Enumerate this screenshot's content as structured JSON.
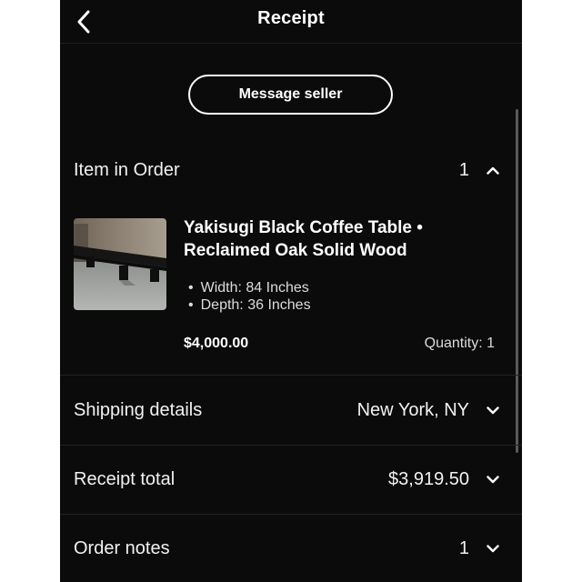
{
  "nav": {
    "title": "Receipt",
    "back_icon": "chevron-left-icon"
  },
  "actions": {
    "message_seller_label": "Message seller"
  },
  "item_section": {
    "label": "Item in Order",
    "count": "1",
    "toggle_icon": "chevron-up-icon",
    "item": {
      "title_line1": "Yakisugi Black Coffee Table •",
      "title_line2": "Reclaimed Oak Solid Wood",
      "specs": [
        "Width: 84 Inches",
        "Depth: 36 Inches"
      ],
      "price": "$4,000.00",
      "quantity": "Quantity: 1"
    }
  },
  "shipping": {
    "label": "Shipping details",
    "value": "New York, NY",
    "toggle_icon": "chevron-down-icon"
  },
  "receipt_total": {
    "label": "Receipt total",
    "value": "$3,919.50",
    "toggle_icon": "chevron-down-icon"
  },
  "order_notes": {
    "label": "Order notes",
    "count": "1",
    "toggle_icon": "chevron-down-icon"
  },
  "colors": {
    "background": "#0b0b0b",
    "text": "#ffffff",
    "divider": "#222222"
  }
}
